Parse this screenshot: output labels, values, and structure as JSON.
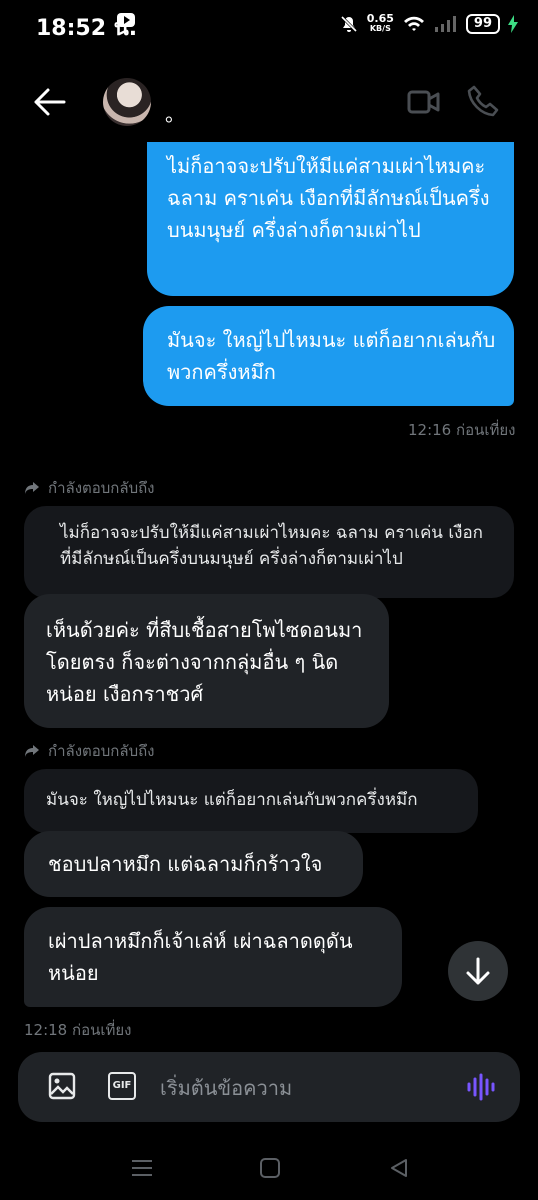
{
  "status_bar": {
    "time": "18:52 น.",
    "speed_value": "0.65",
    "speed_unit": "KB/S",
    "battery": "99"
  },
  "header": {
    "name": "。"
  },
  "messages": {
    "out1": "ไม่ก็อาจจะปรับให้มีแค่สามเผ่าไหมคะ ฉลาม คราเค่น เงือกที่มีลักษณ์เป็นครึ่งบนมนุษย์ ครึ่งล่างก็ตามเผ่าไป",
    "out2": "มันจะ ใหญ่ไปไหมนะ แต่ก็อยากเล่นกับพวกครึ่งหมึก",
    "time1": "12:16 ก่อนเที่ยง",
    "reply_label1": "กำลังตอบกลับถึง",
    "quote1": "ไม่ก็อาจจะปรับให้มีแค่สามเผ่าไหมคะ ฉลาม คราเค่น เงือกที่มีลักษณ์เป็นครึ่งบนมนุษย์ ครึ่งล่างก็ตามเผ่าไป",
    "in1": "เห็นด้วยค่ะ ที่สืบเชื้อสายโพไซดอนมาโดยตรง ก็จะต่างจากกลุ่มอื่น ๆ นิดหน่อย เงือกราชวศ์",
    "reply_label2": "กำลังตอบกลับถึง",
    "quote2": "มันจะ ใหญ่ไปไหมนะ แต่ก็อยากเล่นกับพวกครึ่งหมึก",
    "in2": "ชอบปลาหมึก แต่ฉลามก็กร้าวใจ",
    "in3": "เผ่าปลาหมึกก็เจ้าเล่ห์ เผ่าฉลาดดุดันหน่อย",
    "time2": "12:18 ก่อนเที่ยง"
  },
  "composer": {
    "placeholder": "เริ่มต้นข้อความ",
    "gif_label": "GIF"
  },
  "colors": {
    "accent": "#1d9bf0",
    "bubble_in": "#202327",
    "voice": "#7856ff"
  }
}
